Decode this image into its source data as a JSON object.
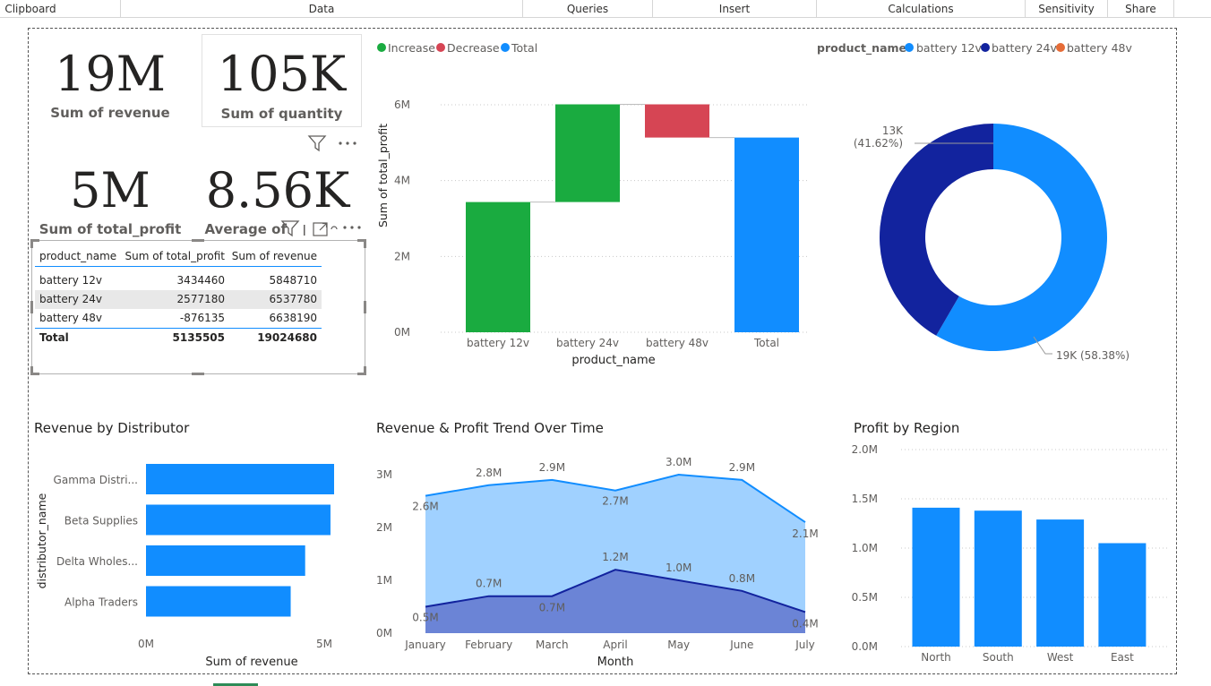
{
  "ribbon": {
    "groups": [
      "Clipboard",
      "Data",
      "Queries",
      "Insert",
      "Calculations",
      "Sensitivity",
      "Share"
    ]
  },
  "cards": {
    "revenue": {
      "value": "19M",
      "label": "Sum of revenue"
    },
    "quantity": {
      "value": "105K",
      "label": "Sum of quantity"
    },
    "profit": {
      "value": "5M",
      "label": "Sum of total_profit"
    },
    "average": {
      "value": "8.56K",
      "label": "Average of"
    }
  },
  "table": {
    "headers": [
      "product_name",
      "Sum of total_profit",
      "Sum of revenue"
    ],
    "rows": [
      [
        "battery 12v",
        "3434460",
        "5848710"
      ],
      [
        "battery 24v",
        "2577180",
        "6537780"
      ],
      [
        "battery 48v",
        "-876135",
        "6638190"
      ]
    ],
    "total": [
      "Total",
      "5135505",
      "19024680"
    ]
  },
  "waterfall": {
    "legend": [
      "Increase",
      "Decrease",
      "Total"
    ],
    "ylabel": "Sum of total_profit",
    "xlabel": "product_name",
    "yticks": [
      "0M",
      "2M",
      "4M",
      "6M"
    ],
    "categories": [
      "battery 12v",
      "battery 24v",
      "battery 48v",
      "Total"
    ],
    "colors": {
      "increase": "#1aab40",
      "decrease": "#d64554",
      "total": "#118dff"
    }
  },
  "donut": {
    "legend_title": "product_name",
    "legend": [
      "battery 12v",
      "battery 24v",
      "battery 48v"
    ],
    "label_small_value": "13K",
    "label_small_pct": "(41.62%)",
    "label_large": "19K (58.38%)",
    "colors": [
      "#118dff",
      "#12239e",
      "#e66c37"
    ]
  },
  "distributor": {
    "title": "Revenue by Distributor",
    "ylabel": "distributor_name",
    "xlabel": "Sum of revenue",
    "categories": [
      "Gamma Distri...",
      "Beta Supplies",
      "Delta Wholes...",
      "Alpha Traders"
    ],
    "xticks": [
      "0M",
      "5M"
    ]
  },
  "trend": {
    "title": "Revenue & Profit Trend Over Time",
    "xlabel": "Month",
    "months": [
      "January",
      "February",
      "March",
      "April",
      "May",
      "June",
      "July"
    ],
    "yticks": [
      "0M",
      "1M",
      "2M",
      "3M"
    ],
    "revenue_labels": [
      "2.6M",
      "2.8M",
      "2.9M",
      "2.7M",
      "3.0M",
      "2.9M",
      "2.1M"
    ],
    "profit_labels": [
      "0.5M",
      "0.7M",
      "0.7M",
      "1.2M",
      "1.0M",
      "0.8M",
      "0.4M"
    ]
  },
  "region": {
    "title": "Profit by Region",
    "categories": [
      "North",
      "South",
      "West",
      "East"
    ],
    "yticks": [
      "0.0M",
      "0.5M",
      "1.0M",
      "1.5M",
      "2.0M"
    ]
  },
  "chart_data": [
    {
      "type": "bar",
      "title": "",
      "categories": [
        "battery 12v",
        "battery 24v",
        "battery 48v",
        "Total"
      ],
      "series": [
        {
          "name": "Increase",
          "values": [
            3434460,
            2577180,
            0,
            0
          ]
        },
        {
          "name": "Decrease",
          "values": [
            0,
            0,
            -876135,
            0
          ]
        },
        {
          "name": "Total",
          "values": [
            0,
            0,
            0,
            5135505
          ]
        }
      ],
      "xlabel": "product_name",
      "ylabel": "Sum of total_profit",
      "ylim": [
        0,
        6000000
      ]
    },
    {
      "type": "pie",
      "title": "",
      "categories": [
        "battery 12v",
        "battery 24v",
        "battery 48v"
      ],
      "values": [
        58.38,
        41.62,
        0
      ]
    },
    {
      "type": "bar",
      "title": "Revenue by Distributor",
      "categories": [
        "Gamma Distri...",
        "Beta Supplies",
        "Delta Wholes...",
        "Alpha Traders"
      ],
      "values": [
        5200000,
        5100000,
        4400000,
        4000000
      ],
      "xlabel": "Sum of revenue",
      "ylabel": "distributor_name",
      "xlim": [
        0,
        5200000
      ]
    },
    {
      "type": "area",
      "title": "Revenue & Profit Trend Over Time",
      "categories": [
        "January",
        "February",
        "March",
        "April",
        "May",
        "June",
        "July"
      ],
      "series": [
        {
          "values": [
            2.6,
            2.8,
            2.9,
            2.7,
            3.0,
            2.9,
            2.1
          ]
        },
        {
          "values": [
            0.5,
            0.7,
            0.7,
            1.2,
            1.0,
            0.8,
            0.4
          ]
        }
      ],
      "xlabel": "Month",
      "ylabel": "",
      "ylim": [
        0,
        3.2
      ]
    },
    {
      "type": "bar",
      "title": "Profit by Region",
      "categories": [
        "North",
        "South",
        "West",
        "East"
      ],
      "values": [
        1.41,
        1.38,
        1.29,
        1.05
      ],
      "ylim": [
        0,
        2.0
      ]
    }
  ]
}
